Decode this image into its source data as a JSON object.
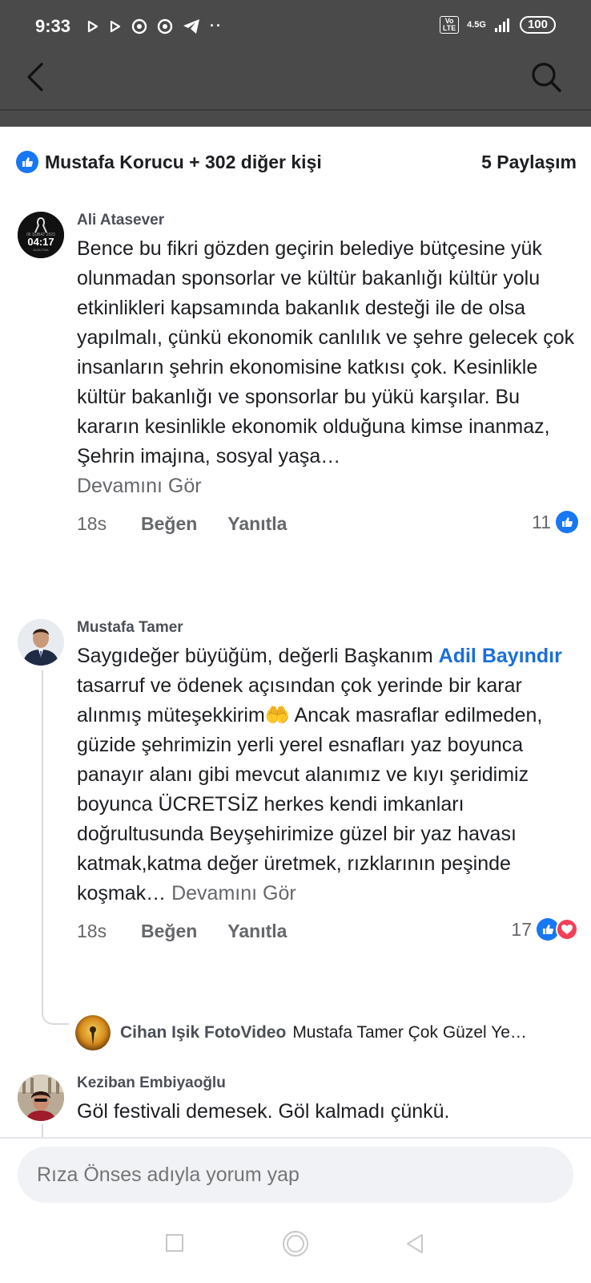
{
  "status_bar": {
    "time": "9:33",
    "battery": "100",
    "network": "4.5G",
    "volte": "Vo LTE",
    "icons": [
      "play-icon",
      "play-icon",
      "chrome-icon",
      "chrome-icon",
      "telegram-icon",
      "more-dots-icon"
    ]
  },
  "reactions_bar": {
    "summary": "Mustafa Korucu + 302 diğer kişi",
    "shares": "5 Paylaşım"
  },
  "comments": [
    {
      "author": "Ali Atasever",
      "avatar_text": {
        "date": "06 ŞUBAT 2023",
        "time": "04:17",
        "tag": "#UNUTMA"
      },
      "text": "Bence bu fikri gözden geçirin belediye bütçesine yük olunmadan sponsorlar ve kültür bakanlığı kültür yolu etkinlikleri kapsamında bakanlık desteği ile de olsa yapılmalı, çünkü ekonomik canlılık ve şehre gelecek çok insanların şehrin ekonomisine katkısı çok. Kesinlikle kültür bakanlığı ve sponsorlar bu yükü karşılar. Bu kararın kesinlikle ekonomik olduğuna kimse inanmaz, Şehrin imajına, sosyal yaşa…",
      "see_more": "Devamını Gör",
      "time": "18s",
      "like": "Beğen",
      "reply": "Yanıtla",
      "reaction_count": "11"
    },
    {
      "author": "Mustafa Tamer",
      "text_before": "Saygıdeğer büyüğüm, değerli Başkanım ",
      "mention": "Adil Bayındır",
      "text_after": " tasarruf ve ödenek açısından çok yerinde bir karar alınmış müteşekkirim🤲 Ancak masraflar edilmeden, güzide şehrimizin yerli yerel esnafları yaz boyunca panayır alanı gibi mevcut alanımız ve kıyı şeridimiz boyunca ÜCRETSİZ herkes kendi imkanları doğrultusunda Beyşehirimize güzel bir yaz havası katmak,katma değer üretmek, rızklarının peşinde koşmak…",
      "see_more": "Devamını Gör",
      "time": "18s",
      "like": "Beğen",
      "reply": "Yanıtla",
      "reaction_count": "17",
      "reply_preview": {
        "author": "Cihan Işik FotoVideo",
        "text": "Mustafa Tamer Çok Güzel Ye…"
      }
    },
    {
      "author": "Keziban Embiyaoğlu",
      "text": "Göl festivali demesek. Göl kalmadı çünkü."
    }
  ],
  "composer": {
    "placeholder": "Rıza Önses adıyla yorum yap"
  },
  "colors": {
    "header": "#4a4a4a",
    "like_blue": "#1877f2",
    "love_red": "#f33e58",
    "mention": "#1a6ed8",
    "muted": "#65676b"
  }
}
